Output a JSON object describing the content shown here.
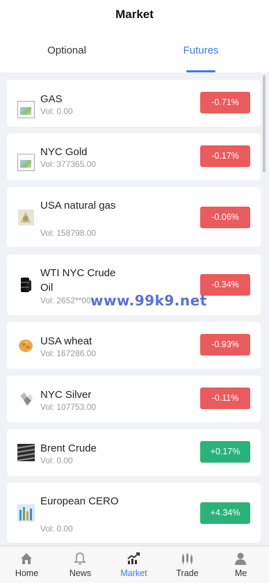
{
  "header": {
    "title": "Market"
  },
  "tabs": [
    {
      "label": "Optional"
    },
    {
      "label": "Futures"
    }
  ],
  "items": [
    {
      "name": "GAS",
      "vol_label": "Vol:",
      "vol": "0.00",
      "change": "-0.71%",
      "direction": "down",
      "icon": "broken-image-icon"
    },
    {
      "name": "NYC Gold",
      "vol_label": "Vol:",
      "vol": "377365.00",
      "change": "-0.17%",
      "direction": "down",
      "icon": "broken-image-icon"
    },
    {
      "name": "USA natural gas",
      "vol_label": "Vol:",
      "vol": "158798.00",
      "change": "-0.06%",
      "direction": "down",
      "icon": "natural-gas-icon"
    },
    {
      "name": "WTI NYC Crude Oil",
      "vol_label": "Vol:",
      "vol": "2652**00",
      "change": "-0.34%",
      "direction": "down",
      "icon": "oil-barrel-icon"
    },
    {
      "name": "USA wheat",
      "vol_label": "Vol:",
      "vol": "167286.00",
      "change": "-0.93%",
      "direction": "down",
      "icon": "wheat-icon"
    },
    {
      "name": "NYC Silver",
      "vol_label": "Vol:",
      "vol": "107753.00",
      "change": "-0.11%",
      "direction": "down",
      "icon": "silver-icon"
    },
    {
      "name": "Brent Crude",
      "vol_label": "Vol:",
      "vol": "0.00",
      "change": "+0.17%",
      "direction": "up",
      "icon": "brent-crude-icon"
    },
    {
      "name": "European CERO",
      "vol_label": "Vol:",
      "vol": "0.00",
      "change": "+4.34%",
      "direction": "up",
      "icon": "cero-icon"
    }
  ],
  "watermark": "www.99k9.net",
  "nav": [
    {
      "label": "Home",
      "icon": "home-icon"
    },
    {
      "label": "News",
      "icon": "bell-icon"
    },
    {
      "label": "Market",
      "icon": "chart-icon"
    },
    {
      "label": "Trade",
      "icon": "candlestick-icon"
    },
    {
      "label": "Me",
      "icon": "user-icon"
    }
  ],
  "colors": {
    "accent": "#3c7be6",
    "down": "#ea5b5e",
    "up": "#2ab27a"
  }
}
